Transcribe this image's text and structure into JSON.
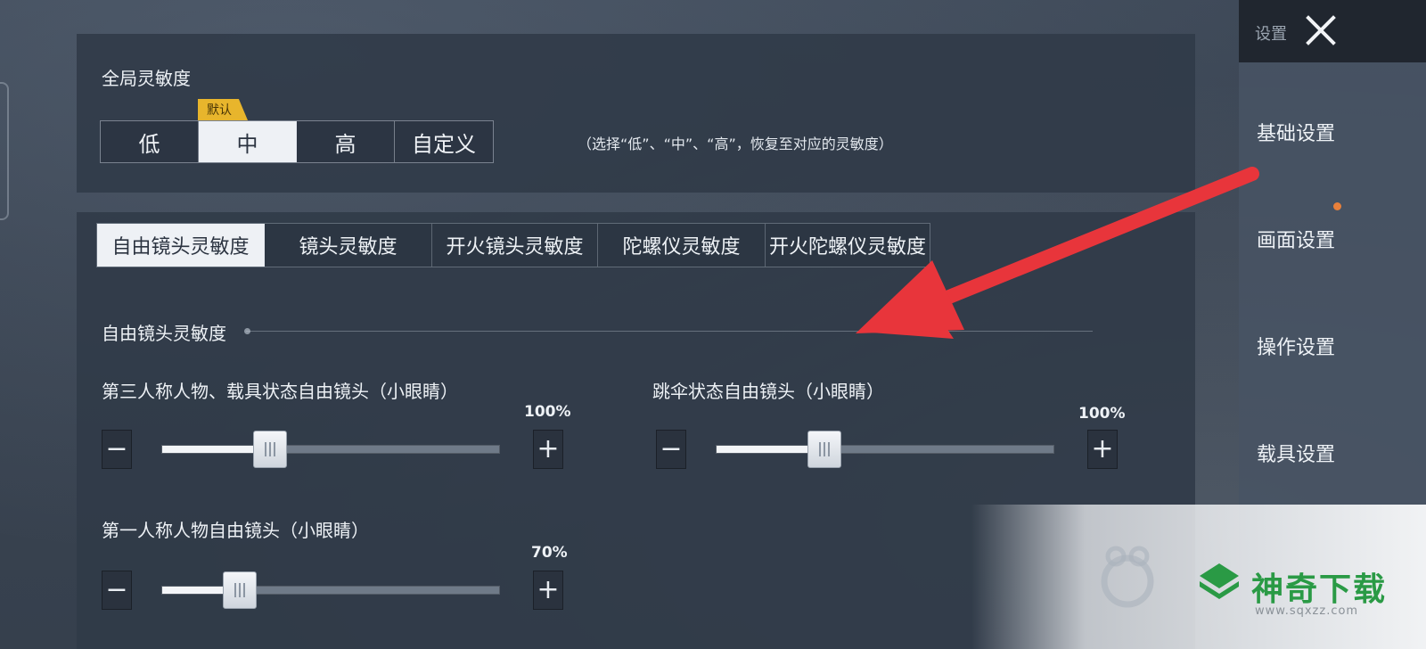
{
  "global": {
    "title": "全局灵敏度",
    "default_tag": "默认",
    "options": [
      "低",
      "中",
      "高",
      "自定义"
    ],
    "selected_index": 1,
    "hint": "（选择“低”、“中”、“高”，恢复至对应的灵敏度）"
  },
  "tabs": {
    "items": [
      "自由镜头灵敏度",
      "镜头灵敏度",
      "开火镜头灵敏度",
      "陀螺仪灵敏度",
      "开火陀螺仪灵敏度"
    ],
    "selected_index": 0
  },
  "section": {
    "title": "自由镜头灵敏度"
  },
  "sliders": [
    {
      "label": "第三人称人物、载具状态自由镜头（小眼睛）",
      "percent_text": "100%",
      "value_fraction": 0.32
    },
    {
      "label": "跳伞状态自由镜头（小眼睛）",
      "percent_text": "100%",
      "value_fraction": 0.32
    },
    {
      "label": "第一人称人物自由镜头（小眼睛）",
      "percent_text": "70%",
      "value_fraction": 0.23
    }
  ],
  "controls": {
    "minus": "−",
    "plus": "+"
  },
  "sidebar": {
    "header": "设置",
    "items": [
      "基础设置",
      "画面设置",
      "操作设置",
      "载具设置"
    ],
    "notification_item_index": 1
  },
  "watermark": {
    "brand": "神奇下载",
    "url": "www.sqxzz.com"
  },
  "colors": {
    "arrow": "#e8353b",
    "default_tag": "#e8b52c",
    "notification_dot": "#e8803a",
    "watermark_green": "#2a9a45"
  }
}
